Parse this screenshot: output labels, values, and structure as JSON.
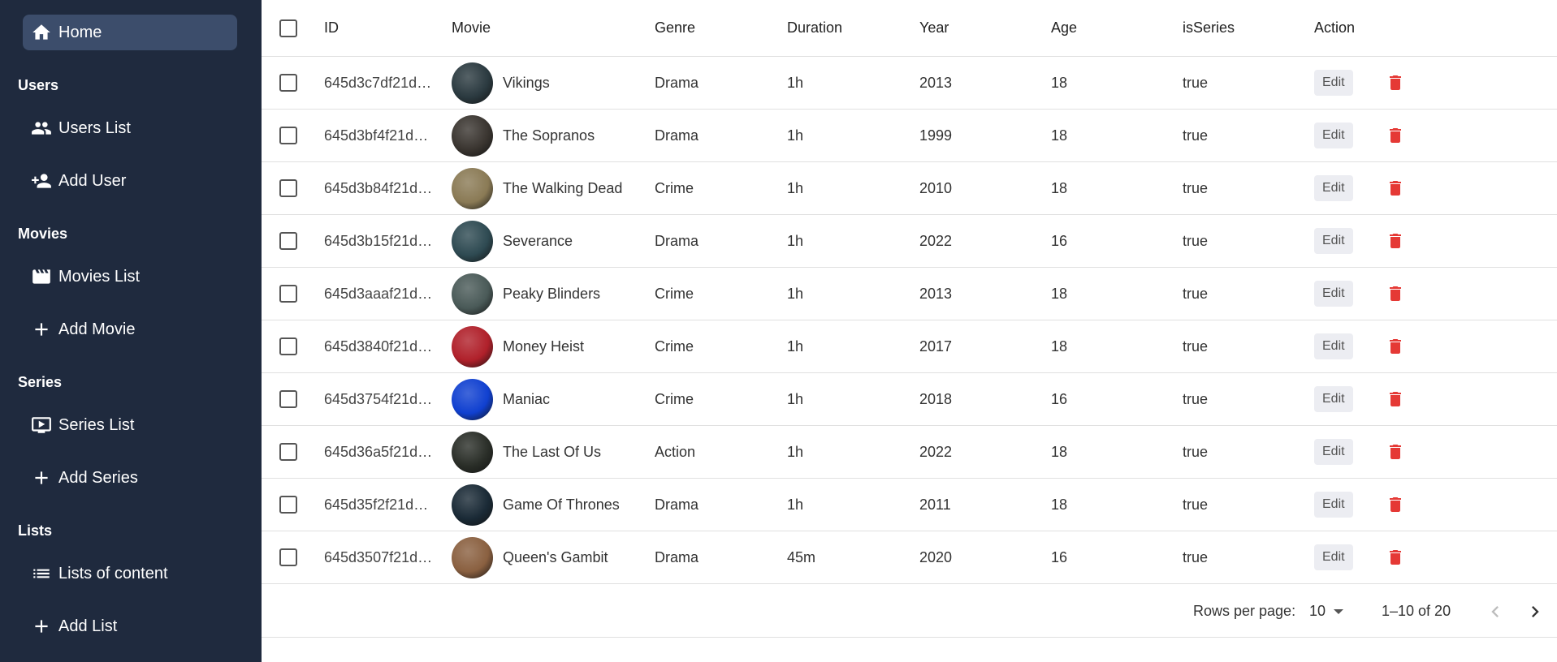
{
  "sidebar": {
    "home_label": "Home",
    "sections": {
      "users": "Users",
      "movies": "Movies",
      "series": "Series",
      "lists": "Lists"
    },
    "items": {
      "users_list": "Users List",
      "add_user": "Add User",
      "movies_list": "Movies List",
      "add_movie": "Add Movie",
      "series_list": "Series List",
      "add_series": "Add Series",
      "lists_of_content": "Lists of content",
      "add_list": "Add List"
    },
    "colors": {
      "background": "#1f2a3e",
      "active": "#3c4d6b"
    }
  },
  "table": {
    "columns": [
      "ID",
      "Movie",
      "Genre",
      "Duration",
      "Year",
      "Age",
      "isSeries",
      "Action"
    ],
    "edit_label": "Edit",
    "rows": [
      {
        "id": "645d3c7df21d…",
        "movie": "Vikings",
        "genre": "Drama",
        "duration": "1h",
        "year": "2013",
        "age": "18",
        "isSeries": "true"
      },
      {
        "id": "645d3bf4f21d…",
        "movie": "The Sopranos",
        "genre": "Drama",
        "duration": "1h",
        "year": "1999",
        "age": "18",
        "isSeries": "true"
      },
      {
        "id": "645d3b84f21d…",
        "movie": "The Walking Dead",
        "genre": "Crime",
        "duration": "1h",
        "year": "2010",
        "age": "18",
        "isSeries": "true"
      },
      {
        "id": "645d3b15f21d…",
        "movie": "Severance",
        "genre": "Drama",
        "duration": "1h",
        "year": "2022",
        "age": "16",
        "isSeries": "true"
      },
      {
        "id": "645d3aaaf21d…",
        "movie": "Peaky Blinders",
        "genre": "Crime",
        "duration": "1h",
        "year": "2013",
        "age": "18",
        "isSeries": "true"
      },
      {
        "id": "645d3840f21d…",
        "movie": "Money Heist",
        "genre": "Crime",
        "duration": "1h",
        "year": "2017",
        "age": "18",
        "isSeries": "true"
      },
      {
        "id": "645d3754f21d…",
        "movie": "Maniac",
        "genre": "Crime",
        "duration": "1h",
        "year": "2018",
        "age": "16",
        "isSeries": "true"
      },
      {
        "id": "645d36a5f21d…",
        "movie": "The Last Of Us",
        "genre": "Action",
        "duration": "1h",
        "year": "2022",
        "age": "18",
        "isSeries": "true"
      },
      {
        "id": "645d35f2f21d…",
        "movie": "Game Of Thrones",
        "genre": "Drama",
        "duration": "1h",
        "year": "2011",
        "age": "18",
        "isSeries": "true"
      },
      {
        "id": "645d3507f21d…",
        "movie": "Queen's Gambit",
        "genre": "Drama",
        "duration": "45m",
        "year": "2020",
        "age": "16",
        "isSeries": "true"
      }
    ],
    "avatar_colors": [
      "#2b3a40",
      "#3a3530",
      "#8a7a55",
      "#2e4a52",
      "#4a5a58",
      "#b0202a",
      "#1040d0",
      "#2a2e28",
      "#1a2a36",
      "#8a6040"
    ]
  },
  "footer": {
    "rows_per_page_label": "Rows per page:",
    "rows_per_page_value": "10",
    "range": "1–10 of 20"
  },
  "icons": {
    "home": "home-icon",
    "users": "people-icon",
    "add_user": "person-add-icon",
    "movies": "movie-icon",
    "add": "plus-icon",
    "series": "tv-play-icon",
    "lists": "list-icon",
    "delete": "trash-icon"
  },
  "accent": {
    "delete": "#e53935"
  }
}
